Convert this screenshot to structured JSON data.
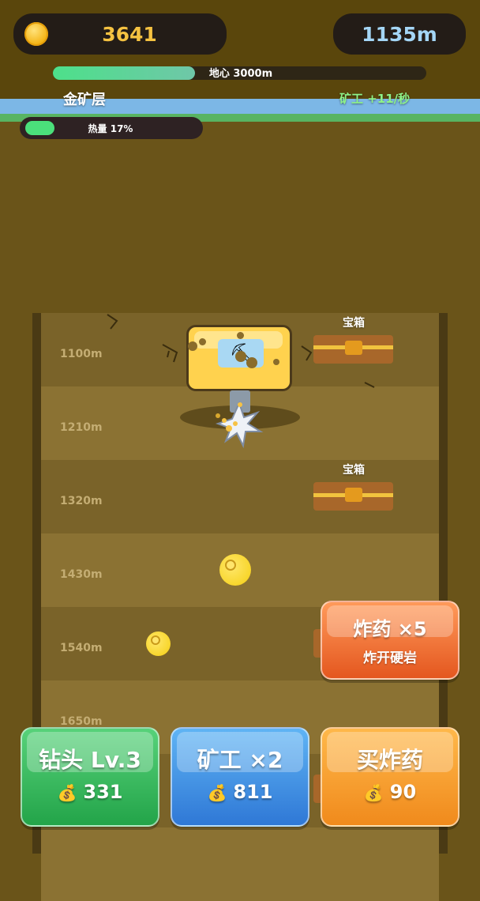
{
  "header": {
    "coins": "3641",
    "depth": "1135m",
    "core_progress_label": "地心 3000m",
    "core_progress_fraction": 0.38,
    "layer_name": "金矿层",
    "miner_rate": "矿工 +11/秒",
    "heat_label": "热量 17%",
    "heat_fraction": 0.17
  },
  "shaft": {
    "rows": [
      {
        "depth": "1100m"
      },
      {
        "depth": "1210m"
      },
      {
        "depth": "1320m"
      },
      {
        "depth": "1430m"
      },
      {
        "depth": "1540m"
      },
      {
        "depth": "1650m"
      }
    ],
    "chest_label": "宝箱",
    "pickaxe_glyph": "⛏"
  },
  "bomb_button": {
    "title": "炸药 ×5",
    "subtitle": "炸开硬岩"
  },
  "actions": {
    "drill": {
      "title": "钻头 Lv.3",
      "cost": "331"
    },
    "miner": {
      "title": "矿工 ×2",
      "cost": "811"
    },
    "buy_bomb": {
      "title": "买炸药",
      "cost": "90"
    },
    "cost_icon": "💰"
  },
  "colors": {
    "coin_text": "#f5c241",
    "depth_text": "#a4d6f6",
    "miner_rate_text": "#8ef28a",
    "progress_fill": "#4de08a",
    "drill_button": "#23a449",
    "miner_button": "#2f78d6",
    "buy_bomb_button": "#f08a1c",
    "bomb_button": "#e4571f"
  }
}
